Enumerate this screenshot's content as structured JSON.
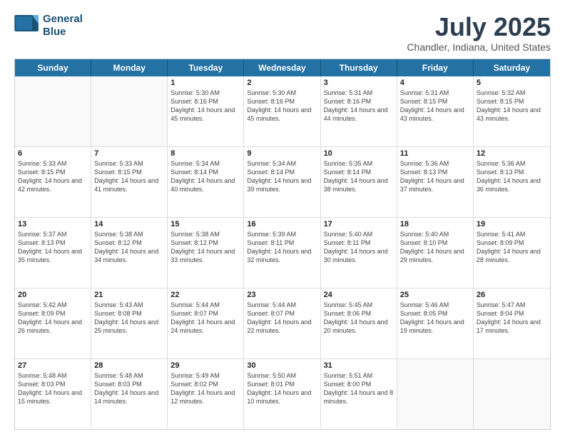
{
  "header": {
    "logo_line1": "General",
    "logo_line2": "Blue",
    "title": "July 2025",
    "location": "Chandler, Indiana, United States"
  },
  "days_of_week": [
    "Sunday",
    "Monday",
    "Tuesday",
    "Wednesday",
    "Thursday",
    "Friday",
    "Saturday"
  ],
  "weeks": [
    [
      {
        "day": "",
        "empty": true
      },
      {
        "day": "",
        "empty": true
      },
      {
        "day": "1",
        "sunrise": "Sunrise: 5:30 AM",
        "sunset": "Sunset: 8:16 PM",
        "daylight": "Daylight: 14 hours and 45 minutes."
      },
      {
        "day": "2",
        "sunrise": "Sunrise: 5:30 AM",
        "sunset": "Sunset: 8:16 PM",
        "daylight": "Daylight: 14 hours and 45 minutes."
      },
      {
        "day": "3",
        "sunrise": "Sunrise: 5:31 AM",
        "sunset": "Sunset: 8:16 PM",
        "daylight": "Daylight: 14 hours and 44 minutes."
      },
      {
        "day": "4",
        "sunrise": "Sunrise: 5:31 AM",
        "sunset": "Sunset: 8:15 PM",
        "daylight": "Daylight: 14 hours and 43 minutes."
      },
      {
        "day": "5",
        "sunrise": "Sunrise: 5:32 AM",
        "sunset": "Sunset: 8:15 PM",
        "daylight": "Daylight: 14 hours and 43 minutes."
      }
    ],
    [
      {
        "day": "6",
        "sunrise": "Sunrise: 5:33 AM",
        "sunset": "Sunset: 8:15 PM",
        "daylight": "Daylight: 14 hours and 42 minutes."
      },
      {
        "day": "7",
        "sunrise": "Sunrise: 5:33 AM",
        "sunset": "Sunset: 8:15 PM",
        "daylight": "Daylight: 14 hours and 41 minutes."
      },
      {
        "day": "8",
        "sunrise": "Sunrise: 5:34 AM",
        "sunset": "Sunset: 8:14 PM",
        "daylight": "Daylight: 14 hours and 40 minutes."
      },
      {
        "day": "9",
        "sunrise": "Sunrise: 5:34 AM",
        "sunset": "Sunset: 8:14 PM",
        "daylight": "Daylight: 14 hours and 39 minutes."
      },
      {
        "day": "10",
        "sunrise": "Sunrise: 5:35 AM",
        "sunset": "Sunset: 8:14 PM",
        "daylight": "Daylight: 14 hours and 38 minutes."
      },
      {
        "day": "11",
        "sunrise": "Sunrise: 5:36 AM",
        "sunset": "Sunset: 8:13 PM",
        "daylight": "Daylight: 14 hours and 37 minutes."
      },
      {
        "day": "12",
        "sunrise": "Sunrise: 5:36 AM",
        "sunset": "Sunset: 8:13 PM",
        "daylight": "Daylight: 14 hours and 36 minutes."
      }
    ],
    [
      {
        "day": "13",
        "sunrise": "Sunrise: 5:37 AM",
        "sunset": "Sunset: 8:13 PM",
        "daylight": "Daylight: 14 hours and 35 minutes."
      },
      {
        "day": "14",
        "sunrise": "Sunrise: 5:38 AM",
        "sunset": "Sunset: 8:12 PM",
        "daylight": "Daylight: 14 hours and 34 minutes."
      },
      {
        "day": "15",
        "sunrise": "Sunrise: 5:38 AM",
        "sunset": "Sunset: 8:12 PM",
        "daylight": "Daylight: 14 hours and 33 minutes."
      },
      {
        "day": "16",
        "sunrise": "Sunrise: 5:39 AM",
        "sunset": "Sunset: 8:11 PM",
        "daylight": "Daylight: 14 hours and 32 minutes."
      },
      {
        "day": "17",
        "sunrise": "Sunrise: 5:40 AM",
        "sunset": "Sunset: 8:11 PM",
        "daylight": "Daylight: 14 hours and 30 minutes."
      },
      {
        "day": "18",
        "sunrise": "Sunrise: 5:40 AM",
        "sunset": "Sunset: 8:10 PM",
        "daylight": "Daylight: 14 hours and 29 minutes."
      },
      {
        "day": "19",
        "sunrise": "Sunrise: 5:41 AM",
        "sunset": "Sunset: 8:09 PM",
        "daylight": "Daylight: 14 hours and 28 minutes."
      }
    ],
    [
      {
        "day": "20",
        "sunrise": "Sunrise: 5:42 AM",
        "sunset": "Sunset: 8:09 PM",
        "daylight": "Daylight: 14 hours and 26 minutes."
      },
      {
        "day": "21",
        "sunrise": "Sunrise: 5:43 AM",
        "sunset": "Sunset: 8:08 PM",
        "daylight": "Daylight: 14 hours and 25 minutes."
      },
      {
        "day": "22",
        "sunrise": "Sunrise: 5:44 AM",
        "sunset": "Sunset: 8:07 PM",
        "daylight": "Daylight: 14 hours and 24 minutes."
      },
      {
        "day": "23",
        "sunrise": "Sunrise: 5:44 AM",
        "sunset": "Sunset: 8:07 PM",
        "daylight": "Daylight: 14 hours and 22 minutes."
      },
      {
        "day": "24",
        "sunrise": "Sunrise: 5:45 AM",
        "sunset": "Sunset: 8:06 PM",
        "daylight": "Daylight: 14 hours and 20 minutes."
      },
      {
        "day": "25",
        "sunrise": "Sunrise: 5:46 AM",
        "sunset": "Sunset: 8:05 PM",
        "daylight": "Daylight: 14 hours and 19 minutes."
      },
      {
        "day": "26",
        "sunrise": "Sunrise: 5:47 AM",
        "sunset": "Sunset: 8:04 PM",
        "daylight": "Daylight: 14 hours and 17 minutes."
      }
    ],
    [
      {
        "day": "27",
        "sunrise": "Sunrise: 5:48 AM",
        "sunset": "Sunset: 8:03 PM",
        "daylight": "Daylight: 14 hours and 15 minutes."
      },
      {
        "day": "28",
        "sunrise": "Sunrise: 5:48 AM",
        "sunset": "Sunset: 8:03 PM",
        "daylight": "Daylight: 14 hours and 14 minutes."
      },
      {
        "day": "29",
        "sunrise": "Sunrise: 5:49 AM",
        "sunset": "Sunset: 8:02 PM",
        "daylight": "Daylight: 14 hours and 12 minutes."
      },
      {
        "day": "30",
        "sunrise": "Sunrise: 5:50 AM",
        "sunset": "Sunset: 8:01 PM",
        "daylight": "Daylight: 14 hours and 10 minutes."
      },
      {
        "day": "31",
        "sunrise": "Sunrise: 5:51 AM",
        "sunset": "Sunset: 8:00 PM",
        "daylight": "Daylight: 14 hours and 8 minutes."
      },
      {
        "day": "",
        "empty": true
      },
      {
        "day": "",
        "empty": true
      }
    ]
  ]
}
